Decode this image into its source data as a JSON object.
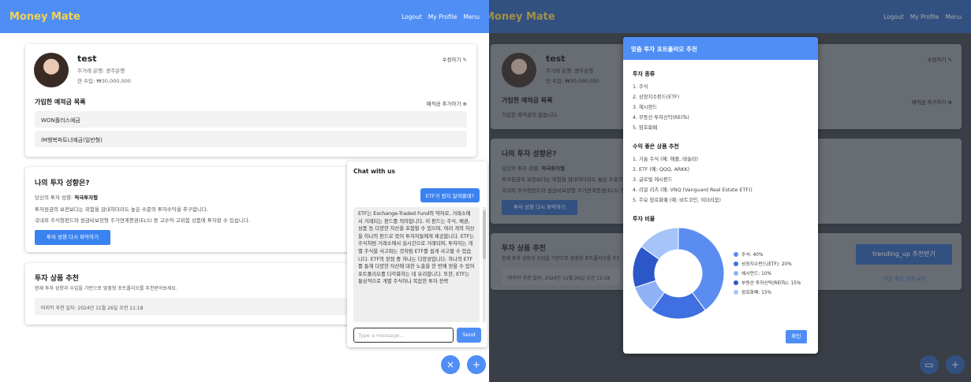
{
  "nav": {
    "brand": "Money Mate",
    "logout": "Logout",
    "profile": "My Profile",
    "menu": "Menu"
  },
  "profile": {
    "name": "test",
    "bank": "주거래 은행: 광주은행",
    "income": "연 수입: ₩30,000,000",
    "edit": "수정하기"
  },
  "deposits": {
    "title": "가입한 예적금 목록",
    "add": "예적금 추가하기",
    "items": [
      "WON플러스예금",
      "iM행복파트너예금(일반형)"
    ],
    "empty": "가입한 예적금이 없습니다."
  },
  "investment": {
    "title": "나의 투자 성향은?",
    "result_prefix": "당신의 투자 성향: ",
    "result_value": "적극투자형",
    "desc1": "투자원금의 보전보다는 위험을 감내하더라도 높은 수준의 투자수익을 추구합니다.",
    "desc2": "국내외 주식형펀드와 원금비보장형 주가연계증권(ELS) 등 고수익·고위험 상품에 투자할 수 있습니다.",
    "retry": "투자 성향 다시 파악하기"
  },
  "recommend": {
    "title": "투자 상품 추천",
    "desc": "현재 투자 성향과 수입을 기반으로 맞춤형 포트폴리오를 추천받아보세요.",
    "last_date": "마지막 추천 일자: 2024년 11월 26일 오전 11:18",
    "button": "trending_up 추천받기",
    "history": "이전 추천 내역 보기"
  },
  "chat": {
    "title": "Chat with us",
    "user_msg": "ETF가 뭔지 알려줄래?",
    "bot_msg": "ETF는 Exchange-Traded Fund의 약자로, 거래소에서 거래되는 펀드를 의미합니다. 이 펀드는 주식, 채권, 상품 등 다양한 자산을 포함할 수 있으며, 여러 개의 자산을 하나의 펀드로 묶어 투자자들에게 제공합니다. ETF는 주식처럼 거래소에서 실시간으로 거래되며, 투자자는 개별 주식을 사고파는 것처럼 ETF를 쉽게 사고팔 수 있습니다. ETF의 장점 중 하나는 다양성입니다. 하나의 ETF를 통해 다양한 자산에 대한 노출을 한 번에 얻을 수 있어 포트폴리오를 다각화하는 데 유리합니다. 또한, ETF는 통상적으로 개별 주식이나 복잡한 투자 전략",
    "placeholder": "Type a message...",
    "send": "Send"
  },
  "fab": {
    "close": "×",
    "add": "+"
  },
  "modal": {
    "title": "맞춤 투자 포트폴리오 추천",
    "types_title": "투자 종류",
    "types": [
      "1. 주식",
      "2. 상장지수펀드(ETF)",
      "3. 헤시펀드",
      "4. 부동산 투자신탁(REITs)",
      "5. 암호화폐"
    ],
    "products_title": "수익 좋은 상품 추천",
    "products": [
      "1. 기술 주식 (예: 애플, 테슬라)",
      "2. ETF (예: QQQ, ARKK)",
      "3. 글로벌 헤시펀드",
      "4. 리얼 리츠 (예: VNQ (Vanguard Real Estate ETF))",
      "5. 주요 암호화폐 (예: 비트코인, 이더리움)"
    ],
    "ratio_title": "투자 비율",
    "confirm": "확인"
  },
  "chart_data": {
    "type": "pie",
    "donut": true,
    "categories": [
      "주식: 40%",
      "상장지수펀드(ETF): 20%",
      "헤시펀드: 10%",
      "부동산 투자신탁(REITs): 15%",
      "암호화폐: 15%"
    ],
    "values": [
      40,
      20,
      10,
      15,
      15
    ],
    "colors": [
      "#5b8df0",
      "#3f6fe0",
      "#8fb2f7",
      "#2c57c9",
      "#a7c4fa"
    ],
    "legend_position": "right"
  }
}
